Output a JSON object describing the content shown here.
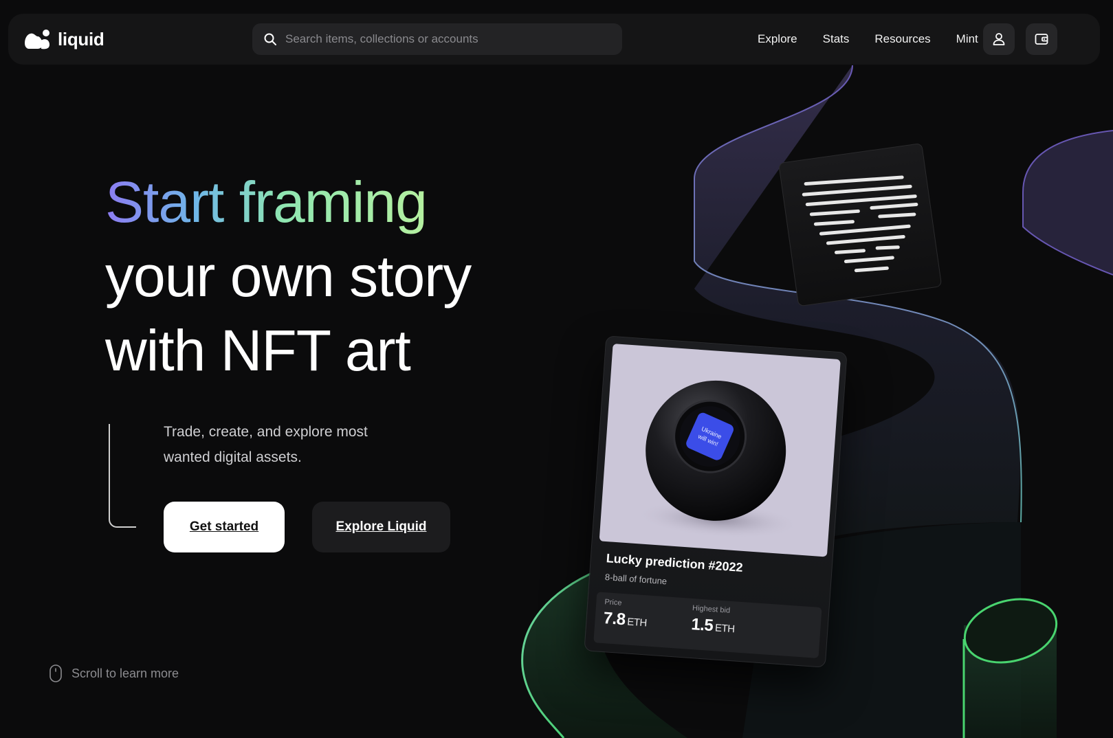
{
  "header": {
    "logo_text": "liquid",
    "search": {
      "placeholder": "Search items, collections or accounts",
      "icon": "search-icon"
    },
    "nav": [
      "Explore",
      "Stats",
      "Resources",
      "Mint"
    ],
    "account_icon": "user-icon",
    "wallet_icon": "wallet-icon"
  },
  "hero": {
    "title_gradient": "Start framing",
    "title_line2": "your own story",
    "title_line3": "with NFT art",
    "description": "Trade, create, and explore most wanted digital assets.",
    "primary_button": "Get started",
    "secondary_button": "Explore Liquid"
  },
  "scroll_hint": {
    "text": "Scroll to learn more",
    "icon": "mouse-icon"
  },
  "nft_card": {
    "screen_text": "Ukraine will win!",
    "title": "Lucky prediction #2022",
    "subtitle": "8-ball of fortune",
    "price_label": "Price",
    "price_value": "7.8",
    "price_unit": "ETH",
    "bid_label": "Highest bid",
    "bid_value": "1.5",
    "bid_unit": "ETH"
  },
  "colors": {
    "background": "#0b0b0c",
    "header_bg": "#151516",
    "ribbon_purple": "#7a66d6",
    "ribbon_teal": "#6fd3c8",
    "ribbon_green": "#4fd67a"
  }
}
